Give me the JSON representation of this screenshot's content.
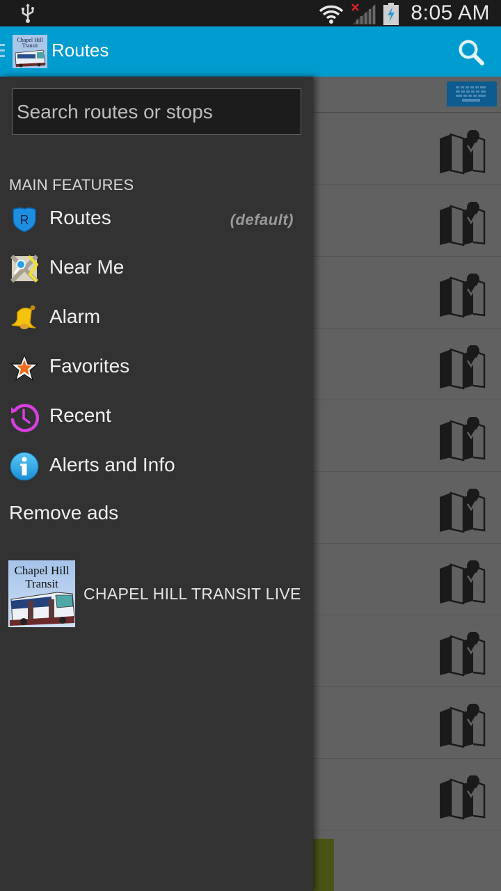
{
  "status_bar": {
    "time": "8:05 AM",
    "icons": [
      "usb-icon",
      "wifi-icon",
      "signal-no-service-icon",
      "battery-charging-icon"
    ]
  },
  "action_bar": {
    "title": "Routes",
    "logo_text_line1": "Chapel Hill",
    "logo_text_line2": "Transit",
    "search_icon": "search-icon"
  },
  "drawer": {
    "search": {
      "placeholder": "Search routes or stops",
      "value": ""
    },
    "section_header": "MAIN FEATURES",
    "items": [
      {
        "label": "Routes",
        "icon": "route-shield-icon",
        "badge": "(default)"
      },
      {
        "label": "Near Me",
        "icon": "map-location-icon"
      },
      {
        "label": "Alarm",
        "icon": "bell-icon"
      },
      {
        "label": "Favorites",
        "icon": "star-icon"
      },
      {
        "label": "Recent",
        "icon": "history-icon"
      },
      {
        "label": "Alerts and Info",
        "icon": "info-icon"
      }
    ],
    "remove_ads": "Remove ads",
    "live_link": {
      "label": "CHAPEL HILL TRANSIT LIVE",
      "logo_line1": "Chapel Hill",
      "logo_line2": "Transit"
    }
  },
  "background_list": {
    "row_count": 10,
    "row_icon": "map-pin-icon",
    "keyboard_icon": "keyboard-icon"
  },
  "colors": {
    "action_bar": "#009ccf",
    "drawer_bg": "#323232",
    "status_bar": "#1b1b1b",
    "recent_icon": "#d63fe0",
    "info_icon": "#2aa8e6",
    "alarm_icon": "#f5c20c",
    "favorites_icon": "#f06a1a"
  }
}
